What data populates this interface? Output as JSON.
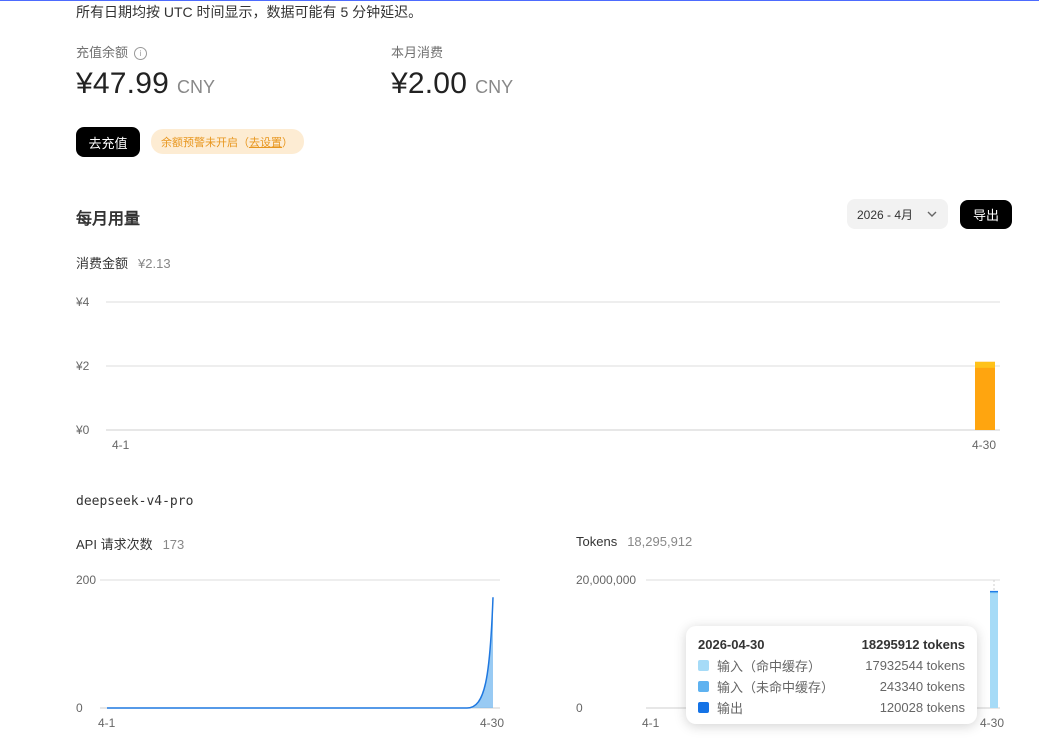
{
  "notice": "所有日期均按 UTC 时间显示，数据可能有 5 分钟延迟。",
  "balance": {
    "label": "充值余额",
    "value": "¥47.99",
    "currency": "CNY"
  },
  "monthly_spend": {
    "label": "本月消费",
    "value": "¥2.00",
    "currency": "CNY"
  },
  "actions": {
    "topup_label": "去充值",
    "alert_text": "余额预警未开启（",
    "alert_link": "去设置",
    "alert_close": "）"
  },
  "usage": {
    "title": "每月用量",
    "month_select": "2026 - 4月",
    "export_label": "导出",
    "cost_label": "消费金额",
    "cost_value": "¥2.13",
    "model_name": "deepseek-v4-pro",
    "api_label": "API 请求次数",
    "api_value": "173",
    "tokens_label": "Tokens",
    "tokens_value": "18,295,912"
  },
  "colors": {
    "accent": "#4d6bfe",
    "cost_bar": "#ffa50f",
    "cost_bar_top": "#ffc21a",
    "api_line": "#1f78e0",
    "cache_hit": "#a6dbf7",
    "cache_miss": "#5eb2f0",
    "output": "#1473e6"
  },
  "tooltip": {
    "date": "2026-04-30",
    "total": "18295912 tokens",
    "rows": [
      {
        "name": "输入（命中缓存）",
        "value": "17932544 tokens",
        "color": "#a6dbf7"
      },
      {
        "name": "输入（未命中缓存）",
        "value": "243340 tokens",
        "color": "#5eb2f0"
      },
      {
        "name": "输出",
        "value": "120028 tokens",
        "color": "#1473e6"
      }
    ]
  },
  "chart_data": [
    {
      "type": "bar",
      "title": "消费金额",
      "x_ticks": [
        "4-1",
        "4-30"
      ],
      "y_ticks": [
        "¥0",
        "¥2",
        "¥4"
      ],
      "ylim": [
        0,
        4
      ],
      "x": [
        "4-30"
      ],
      "values": [
        2.13
      ],
      "grid": true
    },
    {
      "type": "area",
      "title": "API 请求次数",
      "x_ticks": [
        "4-1",
        "4-30"
      ],
      "y_ticks": [
        "0",
        "200"
      ],
      "ylim": [
        0,
        200
      ],
      "x": [
        "4-1",
        "4-30"
      ],
      "values": [
        0,
        173
      ],
      "grid": true
    },
    {
      "type": "bar",
      "title": "Tokens",
      "x_ticks": [
        "4-1",
        "4-30"
      ],
      "y_ticks": [
        "0",
        "20,000,000"
      ],
      "ylim": [
        0,
        20000000
      ],
      "x": [
        "4-30"
      ],
      "series": [
        {
          "name": "输入（命中缓存）",
          "values": [
            17932544
          ]
        },
        {
          "name": "输入（未命中缓存）",
          "values": [
            243340
          ]
        },
        {
          "name": "输出",
          "values": [
            120028
          ]
        }
      ],
      "grid": true
    }
  ]
}
